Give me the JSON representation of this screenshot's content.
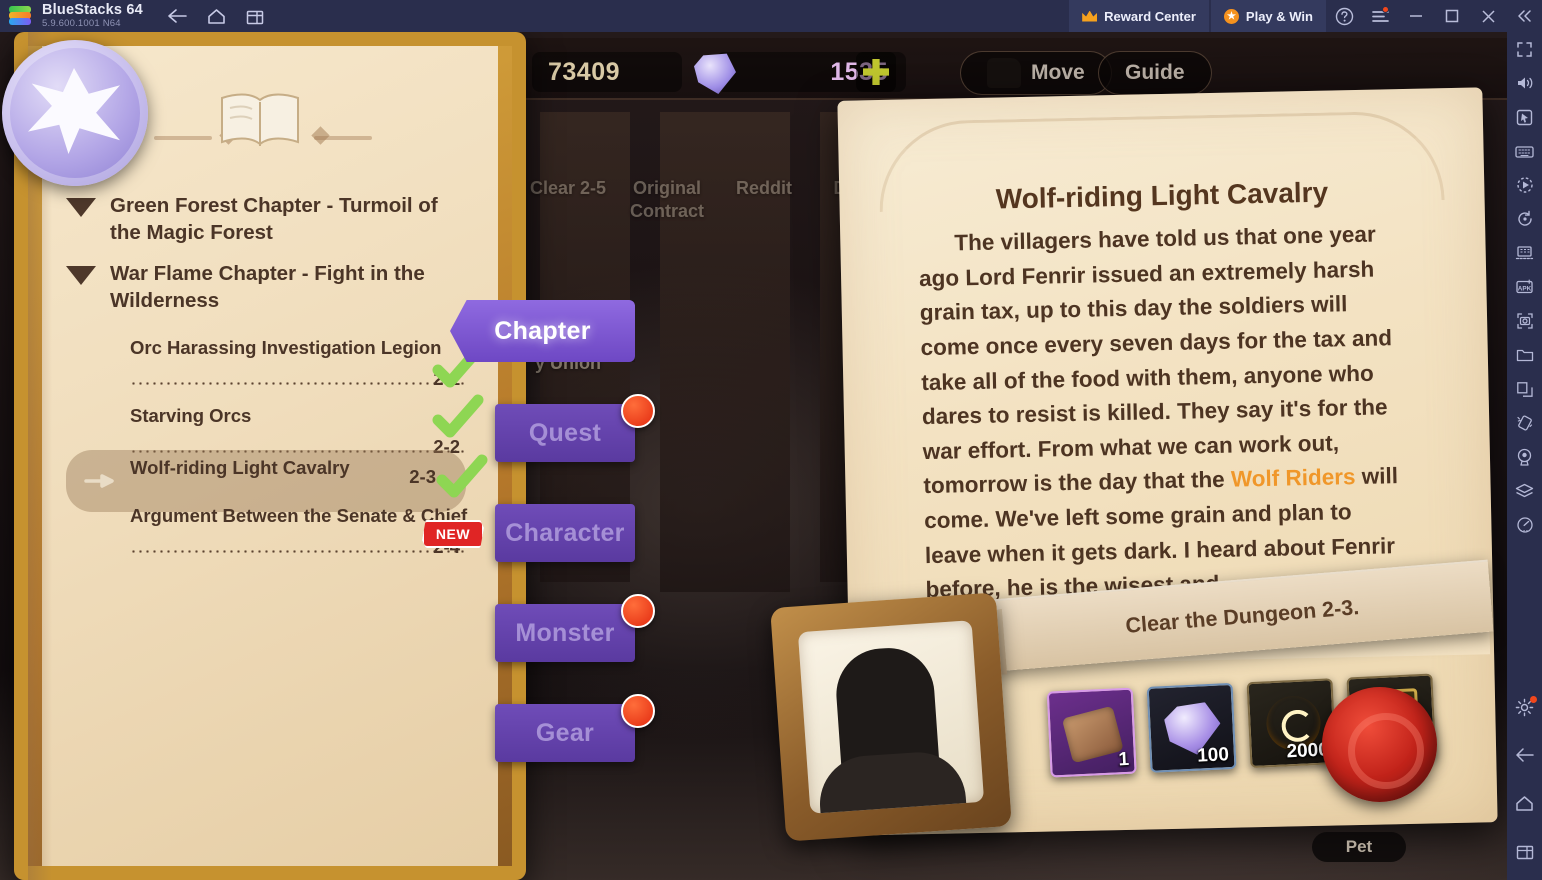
{
  "titlebar": {
    "app_name": "BlueStacks 64",
    "version": "5.9.600.1001  N64",
    "back_icon": "back-arrow-icon",
    "home_icon": "home-icon",
    "multi_instance_icon": "multi-instance-icon",
    "reward_center": "Reward Center",
    "play_and_win": "Play & Win",
    "help_icon": "help-icon",
    "menu_icon": "hamburger-menu-icon",
    "minimize_icon": "minimize-icon",
    "maximize_icon": "maximize-icon",
    "close_icon": "close-icon",
    "collapse_icon": "collapse-icon"
  },
  "hud": {
    "gold": "73409",
    "gems": "1535",
    "plus_label": "+",
    "move_button": "Move",
    "guide_button": "Guide"
  },
  "background_labels": [
    {
      "text": "Clear 2-5"
    },
    {
      "text": "Original Contract"
    },
    {
      "text": "Reddit"
    },
    {
      "text": "De"
    },
    {
      "text": "y Union"
    }
  ],
  "left_panel": {
    "book_icon": "open-book-icon",
    "emblem_icon": "guild-emblem-icon",
    "chapters": [
      {
        "title": "Green Forest Chapter - Turmoil of the Magic Forest",
        "expand_icon": "triangle-down-icon"
      },
      {
        "title": "War Flame Chapter - Fight in the Wilderness",
        "expand_icon": "triangle-down-icon"
      }
    ],
    "quests": [
      {
        "name": "Orc Harassing Investigation Legion",
        "stage": "2-1",
        "status": "complete",
        "selected": false,
        "badge": ""
      },
      {
        "name": "Starving Orcs",
        "stage": "2-2",
        "status": "complete",
        "selected": false,
        "badge": ""
      },
      {
        "name": "Wolf-riding Light Cavalry",
        "stage": "2-3",
        "status": "complete",
        "selected": true,
        "badge": ""
      },
      {
        "name": "Argument Between the Senate & Chief",
        "stage": "2-4",
        "status": "new",
        "selected": false,
        "badge": "NEW"
      }
    ]
  },
  "tabs": [
    {
      "label": "Chapter",
      "active": true,
      "notification": false
    },
    {
      "label": "Quest",
      "active": false,
      "notification": true
    },
    {
      "label": "Character",
      "active": false,
      "notification": false
    },
    {
      "label": "Monster",
      "active": false,
      "notification": true
    },
    {
      "label": "Gear",
      "active": false,
      "notification": true
    }
  ],
  "detail": {
    "title": "Wolf-riding Light Cavalry",
    "body_part1": "The villagers have told us that one year ago Lord Fenrir issued an extremely harsh grain tax, up to this day the soldiers will come once every seven days for the tax and take all of the food with them, anyone who dares to resist is killed. They say it's for the war effort. From what we can work out, tomorrow is the day that the ",
    "body_highlight": "Wolf Riders",
    "body_part2": " will come. We've left some grain and plan to leave when it gets dark. I heard about Fenrir before, he is the wisest and",
    "objective_banner": "Clear the Dungeon 2-3.",
    "rewards": [
      {
        "icon": "scroll-item-icon",
        "count": "1",
        "rarity": "purple"
      },
      {
        "icon": "gem-icon",
        "count": "100",
        "rarity": "blue"
      },
      {
        "icon": "gold-coin-icon",
        "count": "2000",
        "rarity": "gold"
      },
      {
        "icon": "card-item-icon",
        "count": "",
        "rarity": "gold"
      }
    ],
    "wax_seal_icon": "wax-seal-icon",
    "portrait_icon": "character-portrait-silhouette"
  },
  "pet_button": "Pet",
  "right_toolbar": [
    {
      "icon": "fullscreen-icon"
    },
    {
      "icon": "volume-icon"
    },
    {
      "icon": "cursor-pointer-icon"
    },
    {
      "icon": "keyboard-controls-icon"
    },
    {
      "icon": "macro-record-icon"
    },
    {
      "icon": "sync-rotate-icon"
    },
    {
      "icon": "multi-instance-manager-icon"
    },
    {
      "icon": "install-apk-icon"
    },
    {
      "icon": "screenshot-icon"
    },
    {
      "icon": "media-folder-icon"
    },
    {
      "icon": "copy-paste-icon"
    },
    {
      "icon": "shake-icon"
    },
    {
      "icon": "location-pin-icon"
    },
    {
      "icon": "layers-icon"
    },
    {
      "icon": "performance-meter-icon"
    },
    {
      "icon": "settings-gear-icon"
    },
    {
      "icon": "back-arrow-icon"
    },
    {
      "icon": "home-icon"
    },
    {
      "icon": "recent-apps-icon"
    }
  ],
  "colors": {
    "titlebar_bg": "#2a2e4d",
    "accent_purple": "#7d54cf",
    "paper": "#f3e2c2",
    "ink": "#4d3422",
    "highlight_orange": "#f0972a",
    "notification_red": "#e22b10",
    "check_green": "#8ed653"
  }
}
